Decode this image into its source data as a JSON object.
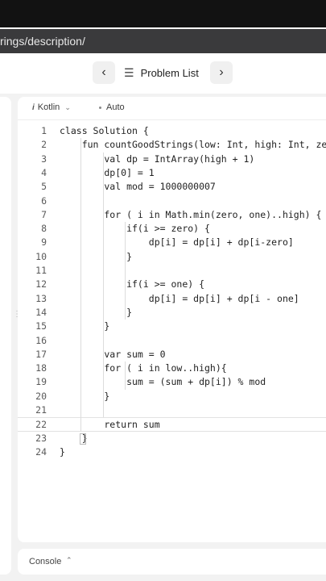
{
  "browser": {
    "url_fragment": "rings/description/"
  },
  "header": {
    "prev_icon": "chevron-left-icon",
    "next_icon": "chevron-right-icon",
    "problem_list_label": "Problem List"
  },
  "editor": {
    "language": "Kotlin",
    "mode": "Auto",
    "active_line": 22,
    "lines": [
      {
        "n": "1",
        "text": "class Solution {"
      },
      {
        "n": "2",
        "text": "    fun countGoodStrings(low: Int, high: Int, zero"
      },
      {
        "n": "3",
        "text": "        val dp = IntArray(high + 1)"
      },
      {
        "n": "4",
        "text": "        dp[0] = 1"
      },
      {
        "n": "5",
        "text": "        val mod = 1000000007"
      },
      {
        "n": "6",
        "text": ""
      },
      {
        "n": "7",
        "text": "        for ( i in Math.min(zero, one)..high) {"
      },
      {
        "n": "8",
        "text": "            if(i >= zero) {"
      },
      {
        "n": "9",
        "text": "                dp[i] = dp[i] + dp[i-zero]"
      },
      {
        "n": "10",
        "text": "            }"
      },
      {
        "n": "11",
        "text": ""
      },
      {
        "n": "12",
        "text": "            if(i >= one) {"
      },
      {
        "n": "13",
        "text": "                dp[i] = dp[i] + dp[i - one]"
      },
      {
        "n": "14",
        "text": "            }"
      },
      {
        "n": "15",
        "text": "        }"
      },
      {
        "n": "16",
        "text": ""
      },
      {
        "n": "17",
        "text": "        var sum = 0"
      },
      {
        "n": "18",
        "text": "        for ( i in low..high){"
      },
      {
        "n": "19",
        "text": "            sum = (sum + dp[i]) % mod"
      },
      {
        "n": "20",
        "text": "        }"
      },
      {
        "n": "21",
        "text": ""
      },
      {
        "n": "22",
        "text": "        return sum"
      },
      {
        "n": "23",
        "text": "    }"
      },
      {
        "n": "24",
        "text": "}"
      }
    ]
  },
  "console": {
    "label": "Console"
  }
}
